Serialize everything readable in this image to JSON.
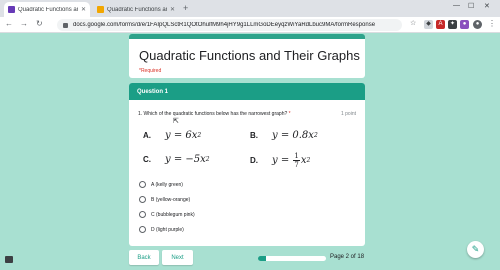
{
  "browser": {
    "tabs": [
      {
        "title": "Quadratic Functions and Their G",
        "favicon_color": "#673ab7"
      },
      {
        "title": "Quadratic Functions and Their G",
        "favicon_color": "#f2a600"
      }
    ],
    "url": "docs.google.com/forms/d/e/1FAIpQLSctR1QOtOhulfM9h4jHY9g1LLmGoDEeyqzWiYaRdLbuc9MA/formResponse"
  },
  "form": {
    "title": "Quadratic Functions and Their Graphs",
    "required_note": "*Required"
  },
  "section": {
    "header": "Question 1",
    "question": "1. Which of the quadratic functions below has the narrowest graph?",
    "required_mark": "*",
    "points": "1 point",
    "equations": {
      "a": {
        "label": "A.",
        "lhs": "y = 6x",
        "exp": "2"
      },
      "b": {
        "label": "B.",
        "lhs": "y = 0.8x",
        "exp": "2"
      },
      "c": {
        "label": "C.",
        "lhs": "y = −5x",
        "exp": "2"
      },
      "d": {
        "label": "D.",
        "lhs": "y = ",
        "num": "1",
        "den": "7",
        "var": "x",
        "exp": "2"
      }
    },
    "options": [
      "A (kelly green)",
      "B (yellow-orange)",
      "C (bubblegum pink)",
      "D (light purple)"
    ]
  },
  "footer": {
    "back_label": "Back",
    "next_label": "Next",
    "progress_fraction": 0.111,
    "page_label": "Page 2 of 18"
  },
  "colors": {
    "background": "#a8e0d1",
    "accent": "#1b9e86",
    "required": "#d93025"
  }
}
